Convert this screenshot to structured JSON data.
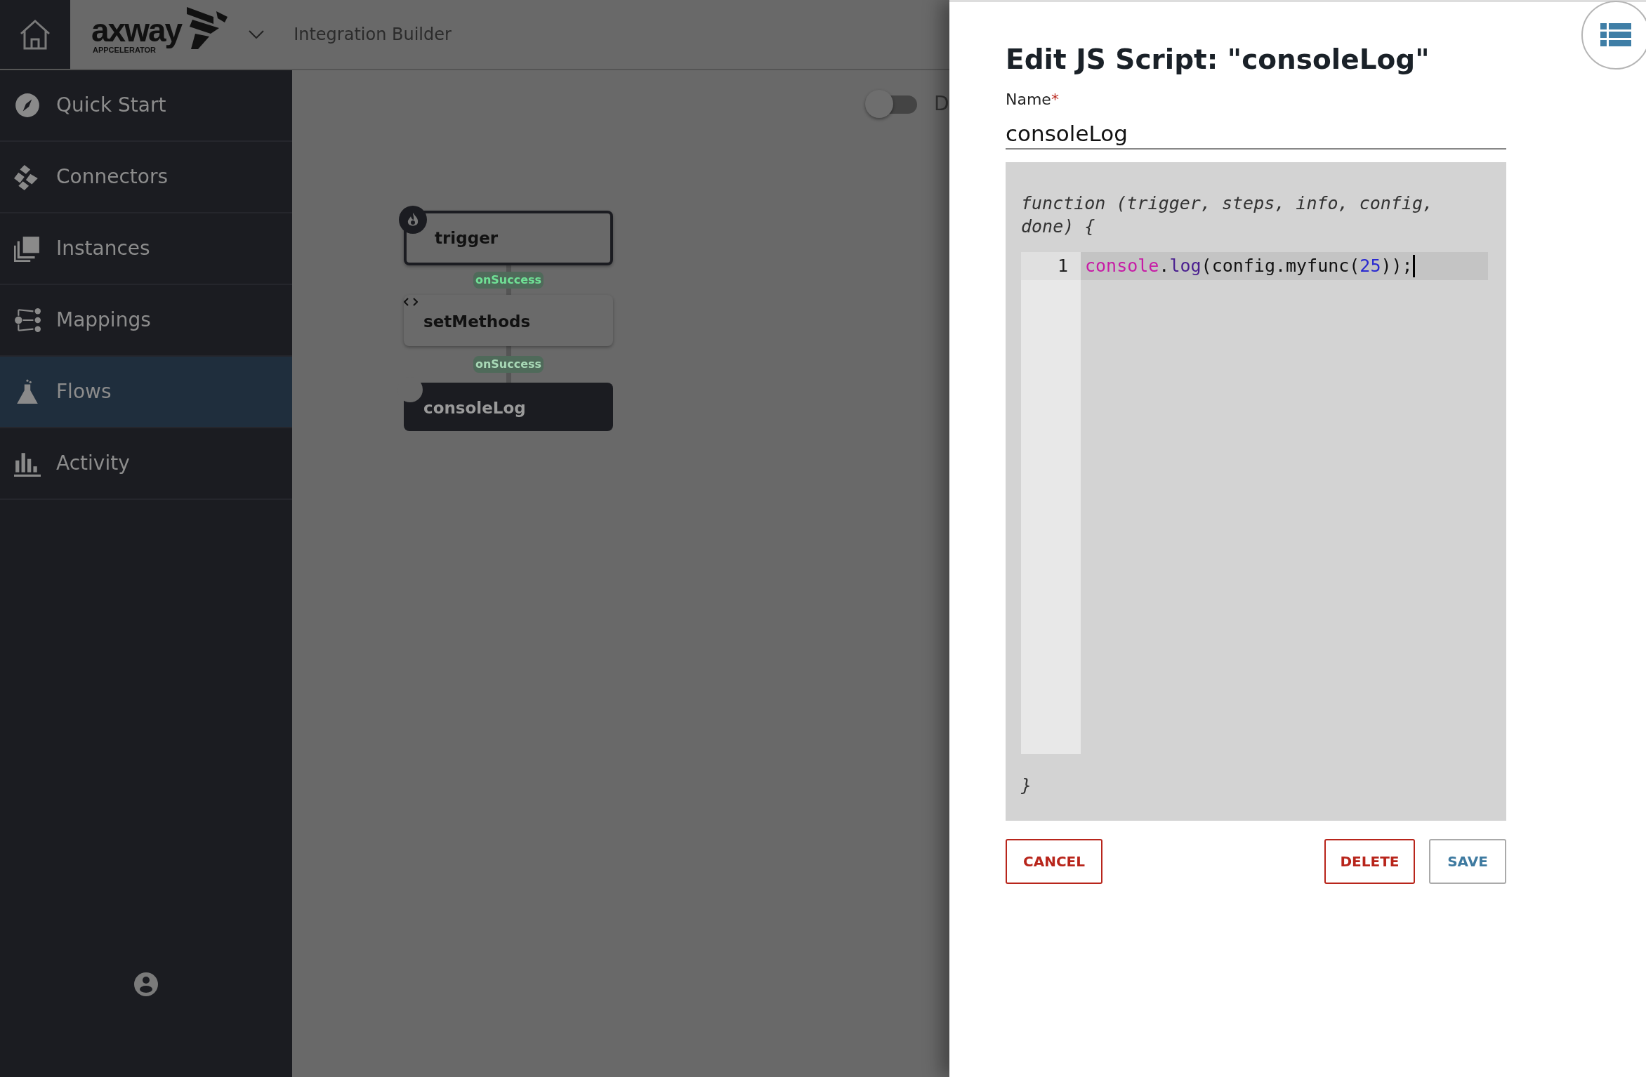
{
  "header": {
    "logo": {
      "wordmark": "axway",
      "tagline": "APPCELERATOR"
    },
    "title": "Integration Builder"
  },
  "sidebar": {
    "items": [
      {
        "label": "Quick Start",
        "selected": false
      },
      {
        "label": "Connectors",
        "selected": false
      },
      {
        "label": "Instances",
        "selected": false
      },
      {
        "label": "Mappings",
        "selected": false
      },
      {
        "label": "Flows",
        "selected": true
      },
      {
        "label": "Activity",
        "selected": false
      }
    ]
  },
  "canvas": {
    "toggle": {
      "on": false,
      "label": "D"
    },
    "nodes": [
      {
        "label": "trigger",
        "kind": "trigger",
        "selected": false
      },
      {
        "label": "setMethods",
        "kind": "script",
        "selected": false
      },
      {
        "label": "consoleLog",
        "kind": "script",
        "selected": true
      }
    ],
    "edges": [
      {
        "label": "onSuccess"
      },
      {
        "label": "onSuccess"
      }
    ]
  },
  "panel": {
    "title": "Edit JS Script: \"consoleLog\"",
    "name_label": "Name",
    "required_mark": "*",
    "name_value": "consoleLog",
    "editor": {
      "header": "function (trigger, steps, info, config, done) {",
      "footer": "}",
      "lines": [
        {
          "number": "1",
          "active": true,
          "tokens": [
            {
              "text": "console",
              "kind": "variable"
            },
            {
              "text": ".",
              "kind": "plain"
            },
            {
              "text": "log",
              "kind": "property"
            },
            {
              "text": "(config.myfunc(",
              "kind": "plain"
            },
            {
              "text": "25",
              "kind": "number"
            },
            {
              "text": "));",
              "kind": "plain"
            }
          ]
        }
      ]
    },
    "buttons": [
      {
        "label": "CANCEL",
        "kind": "danger"
      },
      {
        "label": "DELETE",
        "kind": "danger"
      },
      {
        "label": "SAVE",
        "kind": "primary"
      }
    ]
  }
}
